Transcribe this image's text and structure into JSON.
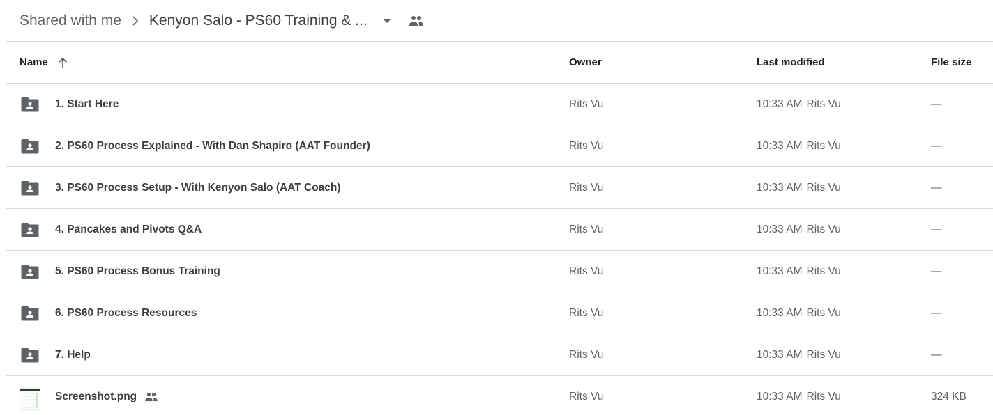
{
  "breadcrumb": {
    "root": "Shared with me",
    "current": "Kenyon Salo - PS60 Training & ...",
    "separator_icon": "chevron-right-icon",
    "dropdown_icon": "arrow-drop-down-icon",
    "shared_icon": "people-icon"
  },
  "table": {
    "columns": {
      "name": "Name",
      "owner": "Owner",
      "last_modified": "Last modified",
      "file_size": "File size"
    },
    "sort_icon": "arrow-up-icon",
    "rows": [
      {
        "type": "shared-folder",
        "name": "1. Start Here",
        "owner": "Rits Vu",
        "modified_time": "10:33 AM",
        "modified_by": "Rits Vu",
        "size": "—"
      },
      {
        "type": "shared-folder",
        "name": "2. PS60 Process Explained - With Dan Shapiro (AAT Founder)",
        "owner": "Rits Vu",
        "modified_time": "10:33 AM",
        "modified_by": "Rits Vu",
        "size": "—"
      },
      {
        "type": "shared-folder",
        "name": "3. PS60 Process Setup - With Kenyon Salo (AAT Coach)",
        "owner": "Rits Vu",
        "modified_time": "10:33 AM",
        "modified_by": "Rits Vu",
        "size": "—"
      },
      {
        "type": "shared-folder",
        "name": "4. Pancakes and Pivots Q&A",
        "owner": "Rits Vu",
        "modified_time": "10:33 AM",
        "modified_by": "Rits Vu",
        "size": "—"
      },
      {
        "type": "shared-folder",
        "name": "5. PS60 Process Bonus Training",
        "owner": "Rits Vu",
        "modified_time": "10:33 AM",
        "modified_by": "Rits Vu",
        "size": "—"
      },
      {
        "type": "shared-folder",
        "name": "6. PS60 Process Resources",
        "owner": "Rits Vu",
        "modified_time": "10:33 AM",
        "modified_by": "Rits Vu",
        "size": "—"
      },
      {
        "type": "shared-folder",
        "name": "7. Help",
        "owner": "Rits Vu",
        "modified_time": "10:33 AM",
        "modified_by": "Rits Vu",
        "size": "—"
      },
      {
        "type": "image-file",
        "name": "Screenshot.png",
        "shared": true,
        "owner": "Rits Vu",
        "modified_time": "10:33 AM",
        "modified_by": "Rits Vu",
        "size": "324 KB"
      }
    ]
  },
  "colors": {
    "icon_gray": "#5f6368",
    "divider": "#dadce0",
    "text_primary": "#3c4043",
    "text_secondary": "#5f6368"
  }
}
